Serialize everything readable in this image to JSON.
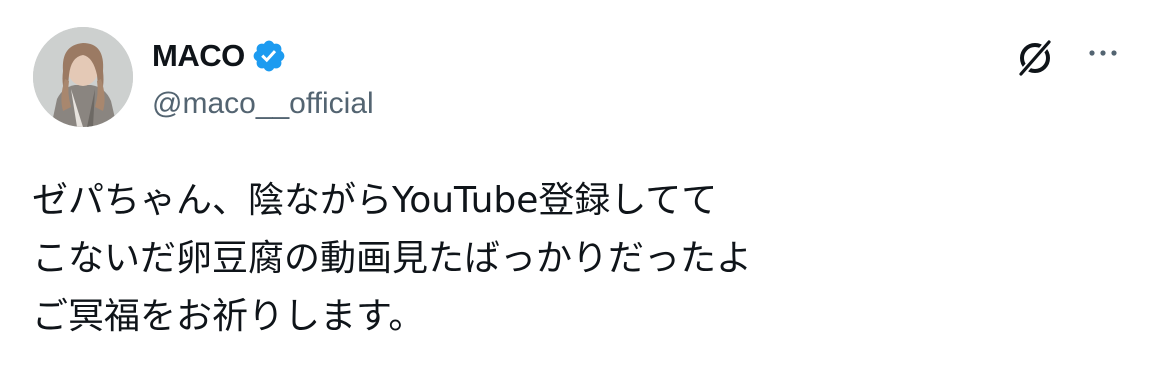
{
  "tweet": {
    "author": {
      "display_name": "MACO",
      "handle": "@maco__official",
      "verified": true,
      "avatar_icon": "user-avatar-photo"
    },
    "text_lines": [
      "ゼパちゃん、陰ながらYouTube登録してて",
      "こないだ卵豆腐の動画見たばっかりだったよ",
      "ご冥福をお祈りします。"
    ],
    "actions": {
      "grok_icon": "grok-icon",
      "more_icon": "more-options-icon"
    }
  },
  "colors": {
    "text_primary": "#0f1419",
    "text_secondary": "#536471",
    "verified_badge": "#1d9bf0",
    "background": "#ffffff"
  }
}
